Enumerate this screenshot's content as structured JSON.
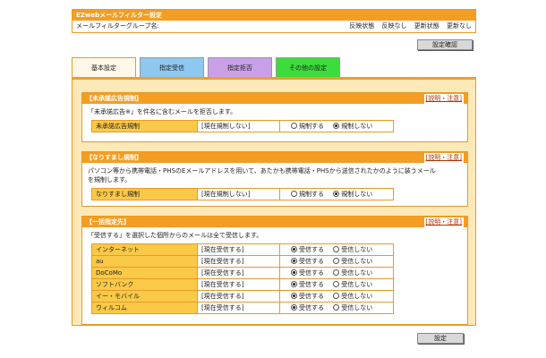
{
  "header": {
    "title": "EZwebメールフィルター設定",
    "group_label": "メールフィルターグループ名:",
    "reflect_status_label": "反映状態",
    "reflect_status_value": "反映なし",
    "update_status_label": "更新状態",
    "update_status_value": "更新なし"
  },
  "buttons": {
    "confirm": "設定確認",
    "set": "設定"
  },
  "tabs": [
    {
      "label": "基本設定",
      "color": "#fff8e8"
    },
    {
      "label": "指定受信",
      "color": "#8ec8f0"
    },
    {
      "label": "指定拒否",
      "color": "#c9a0e8"
    },
    {
      "label": "その他の設定",
      "color": "#3cdc3c"
    }
  ],
  "help_link": "[説明・注意]",
  "sections": [
    {
      "title": "【未承諾広告規制】",
      "desc": "「未承諾広告※」を件名に含むメールを拒否します。",
      "rows": [
        {
          "label": "未承諾広告規制",
          "state": "[現在規制しない]",
          "opt1": "規制する",
          "opt2": "規制しない",
          "selected": 2
        }
      ]
    },
    {
      "title": "【なりすまし規制】",
      "desc_line1": "パソコン等から携帯電話・PHSのEメールアドレスを用いて、あたかも携帯電話・PHSから送信されたかのように装うメール",
      "desc_line2": "を規制します。",
      "rows": [
        {
          "label": "なりすまし規制",
          "state": "[現在規制しない]",
          "opt1": "規制する",
          "opt2": "規制しない",
          "selected": 2
        }
      ]
    },
    {
      "title": "【一括指定先】",
      "desc": "「受信する」を選択した個所からのメールは全て受信します。",
      "rows": [
        {
          "label": "インターネット",
          "state": "[現在受信する]",
          "opt1": "受信する",
          "opt2": "受信しない",
          "selected": 1
        },
        {
          "label": "au",
          "state": "[現在受信する]",
          "opt1": "受信する",
          "opt2": "受信しない",
          "selected": 1
        },
        {
          "label": "DoCoMo",
          "state": "[現在受信する]",
          "opt1": "受信する",
          "opt2": "受信しない",
          "selected": 1
        },
        {
          "label": "ソフトバンク",
          "state": "[現在受信する]",
          "opt1": "受信する",
          "opt2": "受信しない",
          "selected": 1
        },
        {
          "label": "イー・モバイル",
          "state": "[現在受信する]",
          "opt1": "受信する",
          "opt2": "受信しない",
          "selected": 1
        },
        {
          "label": "ウィルコム",
          "state": "[現在受信する]",
          "opt1": "受信する",
          "opt2": "受信しない",
          "selected": 1
        }
      ]
    }
  ]
}
